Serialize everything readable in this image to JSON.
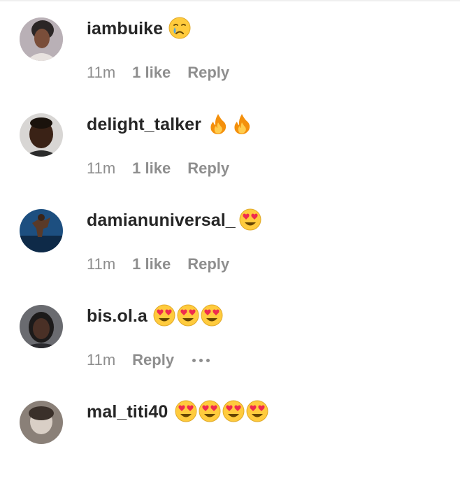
{
  "comments": [
    {
      "username": "iambuike",
      "emojis": [
        "crying-face"
      ],
      "time": "11m",
      "likes": "1 like",
      "reply": "Reply",
      "avatar_bg": "#cfc6c8"
    },
    {
      "username": "delight_talker",
      "emojis": [
        "fire",
        "fire"
      ],
      "time": "11m",
      "likes": "1 like",
      "reply": "Reply",
      "avatar_bg": "#d8d6d4"
    },
    {
      "username": "damianuniversal_",
      "emojis": [
        "heart-eyes"
      ],
      "time": "11m",
      "likes": "1 like",
      "reply": "Reply",
      "avatar_bg": "#1d4f80"
    },
    {
      "username": "bis.ol.a",
      "emojis": [
        "heart-eyes",
        "heart-eyes",
        "heart-eyes"
      ],
      "time": "11m",
      "likes": "",
      "reply": "Reply",
      "has_more": true,
      "avatar_bg": "#6a6b70"
    },
    {
      "username": "mal_titi40",
      "emojis": [
        "heart-eyes",
        "heart-eyes",
        "heart-eyes",
        "heart-eyes"
      ],
      "time": "",
      "likes": "",
      "reply": "",
      "avatar_bg": "#8a8078"
    }
  ],
  "colors": {
    "username": "#262626",
    "meta": "#8e8e8e",
    "emoji_yellow": "#ffcb3d",
    "heart_red": "#ef2b4e",
    "fire_orange": "#f4900c"
  }
}
